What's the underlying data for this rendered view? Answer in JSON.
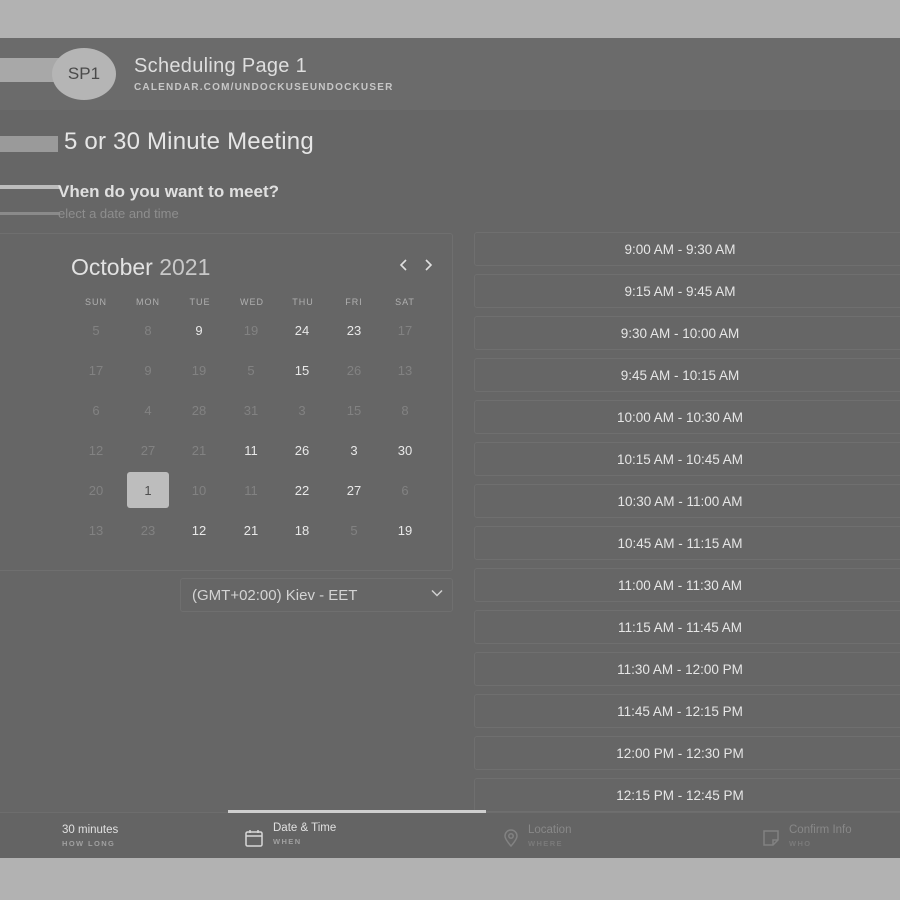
{
  "header": {
    "avatar_initials": "SP1",
    "title": "Scheduling Page 1",
    "url": "CALENDAR.COM/UNDOCKUSEUNDOCKUSER"
  },
  "meeting": {
    "title": "5 or 30 Minute Meeting",
    "question": "Vhen do you want to meet?",
    "subtitle": "elect a date and time"
  },
  "calendar": {
    "month": "October",
    "year": "2021",
    "prev_icon": "chevron-left-icon",
    "next_icon": "chevron-right-icon",
    "weekdays": [
      "SUN",
      "MON",
      "TUE",
      "WED",
      "THU",
      "FRI",
      "SAT"
    ],
    "weeks": [
      [
        {
          "d": "5",
          "active": false
        },
        {
          "d": "8",
          "active": false
        },
        {
          "d": "9",
          "active": true
        },
        {
          "d": "19",
          "active": false
        },
        {
          "d": "24",
          "active": true
        },
        {
          "d": "23",
          "active": true
        },
        {
          "d": "17",
          "active": false
        }
      ],
      [
        {
          "d": "17",
          "active": false
        },
        {
          "d": "9",
          "active": false
        },
        {
          "d": "19",
          "active": false
        },
        {
          "d": "5",
          "active": false
        },
        {
          "d": "15",
          "active": true
        },
        {
          "d": "26",
          "active": false
        },
        {
          "d": "13",
          "active": false
        }
      ],
      [
        {
          "d": "6",
          "active": false
        },
        {
          "d": "4",
          "active": false
        },
        {
          "d": "28",
          "active": false
        },
        {
          "d": "31",
          "active": false
        },
        {
          "d": "3",
          "active": false
        },
        {
          "d": "15",
          "active": false
        },
        {
          "d": "8",
          "active": false
        }
      ],
      [
        {
          "d": "12",
          "active": false
        },
        {
          "d": "27",
          "active": false
        },
        {
          "d": "21",
          "active": false
        },
        {
          "d": "11",
          "active": true
        },
        {
          "d": "26",
          "active": true
        },
        {
          "d": "3",
          "active": true
        },
        {
          "d": "30",
          "active": true
        }
      ],
      [
        {
          "d": "20",
          "active": false
        },
        {
          "d": "1",
          "active": true,
          "selected": true
        },
        {
          "d": "10",
          "active": false
        },
        {
          "d": "11",
          "active": false
        },
        {
          "d": "22",
          "active": true
        },
        {
          "d": "27",
          "active": true
        },
        {
          "d": "6",
          "active": false
        }
      ],
      [
        {
          "d": "13",
          "active": false
        },
        {
          "d": "23",
          "active": false
        },
        {
          "d": "12",
          "active": true
        },
        {
          "d": "21",
          "active": true
        },
        {
          "d": "18",
          "active": true
        },
        {
          "d": "5",
          "active": false
        },
        {
          "d": "19",
          "active": true
        }
      ]
    ]
  },
  "timezone": {
    "value": "(GMT+02:00) Kiev - EET",
    "icon": "chevron-down-icon"
  },
  "time_slots": [
    "9:00 AM - 9:30 AM",
    "9:15 AM - 9:45 AM",
    "9:30 AM - 10:00 AM",
    "9:45 AM - 10:15 AM",
    "10:00 AM - 10:30 AM",
    "10:15 AM - 10:45 AM",
    "10:30 AM - 11:00 AM",
    "10:45 AM - 11:15 AM",
    "11:00 AM - 11:30 AM",
    "11:15 AM - 11:45 AM",
    "11:30 AM - 12:00 PM",
    "11:45 AM - 12:15 PM",
    "12:00 PM - 12:30 PM",
    "12:15 PM - 12:45 PM"
  ],
  "steps": [
    {
      "label": "30 minutes",
      "sub": "HOW LONG",
      "icon": "",
      "active": true
    },
    {
      "label": "Date & Time",
      "sub": "WHEN",
      "icon": "calendar-icon",
      "active": true
    },
    {
      "label": "Location",
      "sub": "WHERE",
      "icon": "location-pin-icon",
      "active": false
    },
    {
      "label": "Confirm Info",
      "sub": "WHO",
      "icon": "note-icon",
      "active": false
    }
  ]
}
